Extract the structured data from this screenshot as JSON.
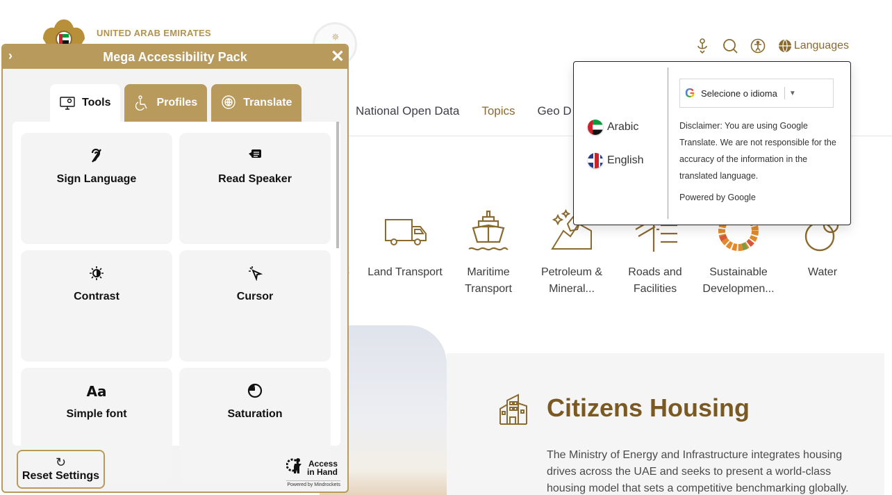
{
  "header": {
    "logo_text": "UNITED ARAB EMIRATES",
    "icons": [
      "sign-language-icon",
      "search-icon",
      "accessibility-icon"
    ],
    "languages_label": "Languages"
  },
  "nav": {
    "items": [
      {
        "label": "National Open Data",
        "active": false
      },
      {
        "label": "Topics",
        "active": true
      },
      {
        "label": "Geo D",
        "active": false
      }
    ]
  },
  "topics": {
    "partial_label": "t",
    "items": [
      {
        "label": "Land Transport",
        "icon": "truck-icon"
      },
      {
        "label": "Maritime Transport",
        "icon": "ship-icon"
      },
      {
        "label": "Petroleum & Mineral...",
        "icon": "minerals-icon"
      },
      {
        "label": "Roads and Facilities",
        "icon": "roads-icon"
      },
      {
        "label": "Sustainable Developmen...",
        "icon": "sdg-wheel-icon"
      },
      {
        "label": "Water",
        "icon": "water-drop-icon"
      }
    ]
  },
  "housing": {
    "title": "Citizens Housing",
    "description": "The Ministry of Energy and Infrastructure integrates housing drives across the UAE and seeks to present a world-class housing model that sets a competitive benchmarking globally."
  },
  "language_popup": {
    "languages": [
      {
        "label": "Arabic",
        "flag": "uae-flag"
      },
      {
        "label": "English",
        "flag": "uk-flag"
      }
    ],
    "translate_select": "Selecione o idioma",
    "disclaimer": "Disclaimer: You are using Google Translate. We are not responsible for the accuracy of the information in the translated language.",
    "powered_by": "Powered by Google"
  },
  "accessibility_panel": {
    "title": "Mega Accessibility Pack",
    "tabs": [
      {
        "label": "Tools",
        "active": true,
        "icon": "monitor-gear-icon"
      },
      {
        "label": "Profiles",
        "active": false,
        "icon": "wheelchair-icon"
      },
      {
        "label": "Translate",
        "active": false,
        "icon": "globe-chat-icon"
      }
    ],
    "tools": [
      {
        "label": "Sign Language",
        "icon": "ear-icon"
      },
      {
        "label": "Read Speaker",
        "icon": "speaker-icon"
      },
      {
        "label": "Contrast",
        "icon": "contrast-icon"
      },
      {
        "label": "Cursor",
        "icon": "cursor-icon"
      },
      {
        "label": "Simple font",
        "icon": "font-icon"
      },
      {
        "label": "Saturation",
        "icon": "saturation-icon"
      }
    ],
    "reset_label": "Reset Settings",
    "brand_line1": "Access",
    "brand_line2": "in Hand",
    "brand_sub": "Powered by Mindrockets"
  }
}
